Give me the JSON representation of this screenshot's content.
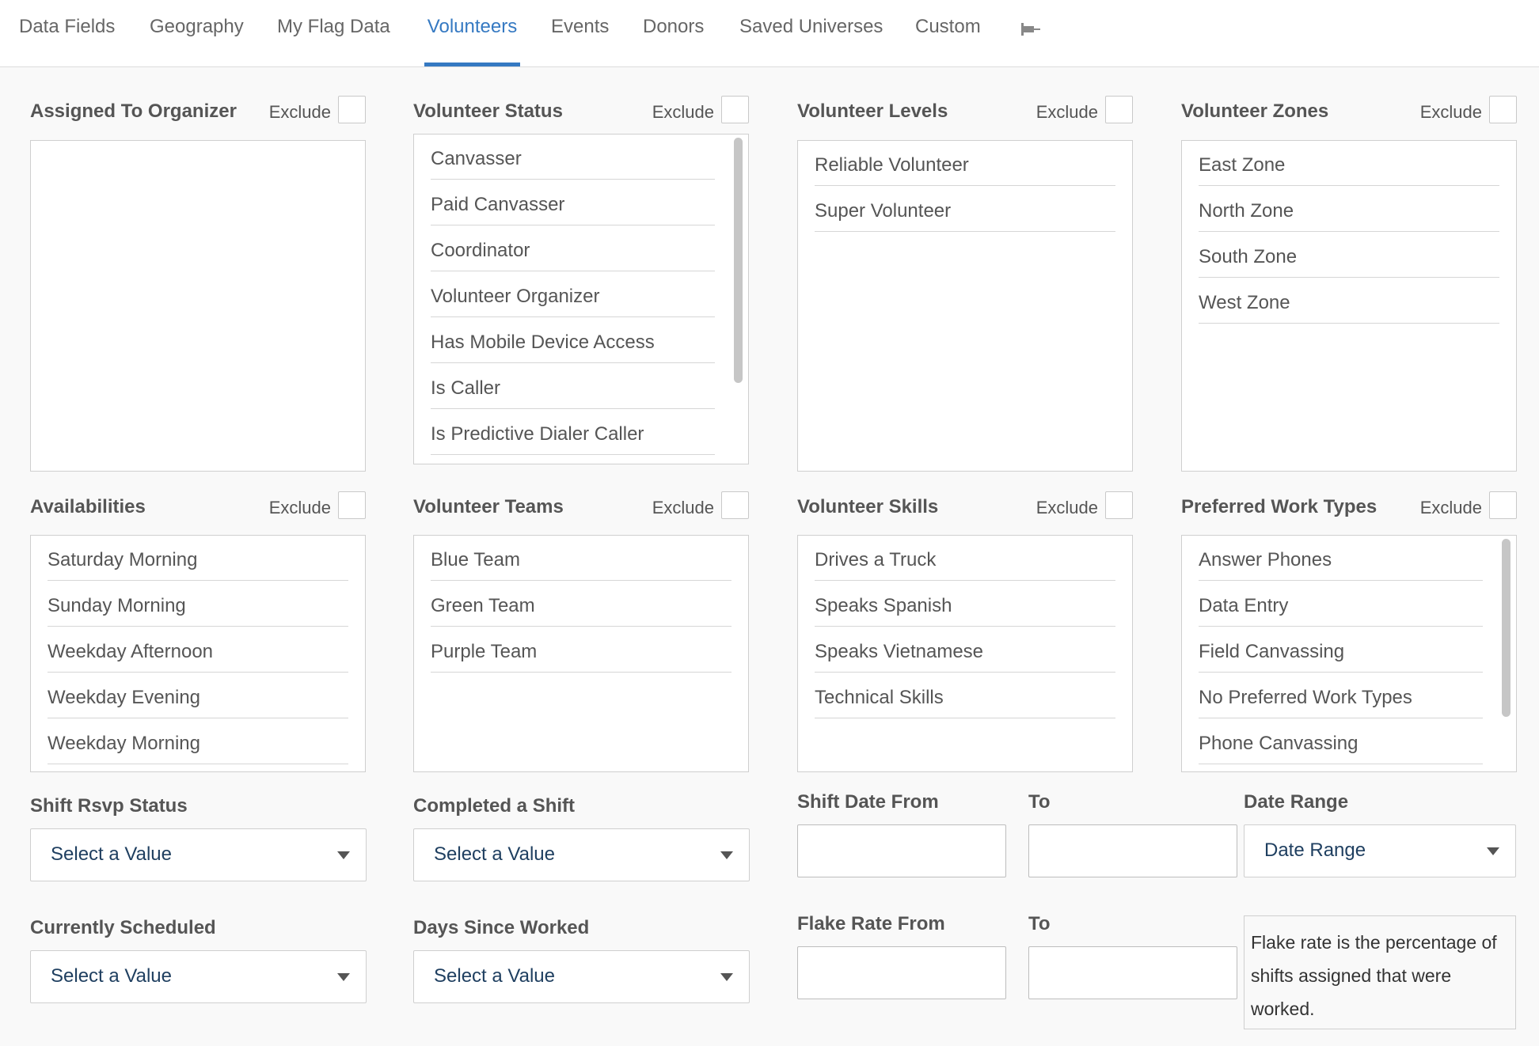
{
  "tabs": [
    {
      "label": "Data Fields"
    },
    {
      "label": "Geography"
    },
    {
      "label": "My Flag Data"
    },
    {
      "label": "Volunteers",
      "active": true
    },
    {
      "label": "Events"
    },
    {
      "label": "Donors"
    },
    {
      "label": "Saved Universes"
    },
    {
      "label": "Custom"
    }
  ],
  "exclude_label": "Exclude",
  "filters": {
    "assigned_to_organizer": {
      "title": "Assigned To Organizer",
      "items": []
    },
    "volunteer_status": {
      "title": "Volunteer Status",
      "items": [
        "Canvasser",
        "Paid Canvasser",
        "Coordinator",
        "Volunteer Organizer",
        "Has Mobile Device Access",
        "Is Caller",
        "Is Predictive Dialer Caller"
      ]
    },
    "volunteer_levels": {
      "title": "Volunteer Levels",
      "items": [
        "Reliable Volunteer",
        "Super Volunteer"
      ]
    },
    "volunteer_zones": {
      "title": "Volunteer Zones",
      "items": [
        "East Zone",
        "North Zone",
        "South Zone",
        "West Zone"
      ]
    },
    "availabilities": {
      "title": "Availabilities",
      "items": [
        "Saturday Morning",
        "Sunday Morning",
        "Weekday Afternoon",
        "Weekday Evening",
        "Weekday Morning"
      ]
    },
    "volunteer_teams": {
      "title": "Volunteer Teams",
      "items": [
        "Blue Team",
        "Green Team",
        "Purple Team"
      ]
    },
    "volunteer_skills": {
      "title": "Volunteer Skills",
      "items": [
        "Drives a Truck",
        "Speaks Spanish",
        "Speaks Vietnamese",
        "Technical Skills"
      ]
    },
    "preferred_work_types": {
      "title": "Preferred Work Types",
      "items": [
        "Answer Phones",
        "Data Entry",
        "Field Canvassing",
        "No Preferred Work Types",
        "Phone Canvassing"
      ]
    }
  },
  "fields": {
    "shift_rsvp_status": {
      "label": "Shift Rsvp Status",
      "value": "Select a Value"
    },
    "completed_a_shift": {
      "label": "Completed a Shift",
      "value": "Select a Value"
    },
    "currently_scheduled": {
      "label": "Currently Scheduled",
      "value": "Select a Value"
    },
    "days_since_worked": {
      "label": "Days Since Worked",
      "value": "Select a Value"
    },
    "shift_date_from": {
      "label": "Shift Date From",
      "value": ""
    },
    "shift_date_to": {
      "label": "To",
      "value": ""
    },
    "date_range": {
      "label": "Date Range",
      "value": "Date Range"
    },
    "flake_rate_from": {
      "label": "Flake Rate From",
      "value": ""
    },
    "flake_rate_to": {
      "label": "To",
      "value": ""
    },
    "flake_rate_help": "Flake rate is the percentage of shifts assigned that were worked."
  },
  "icons": {
    "pin": "pushpin-icon"
  },
  "colors": {
    "accent": "#3579c2",
    "text": "#555555",
    "border": "#cfcfcf"
  }
}
